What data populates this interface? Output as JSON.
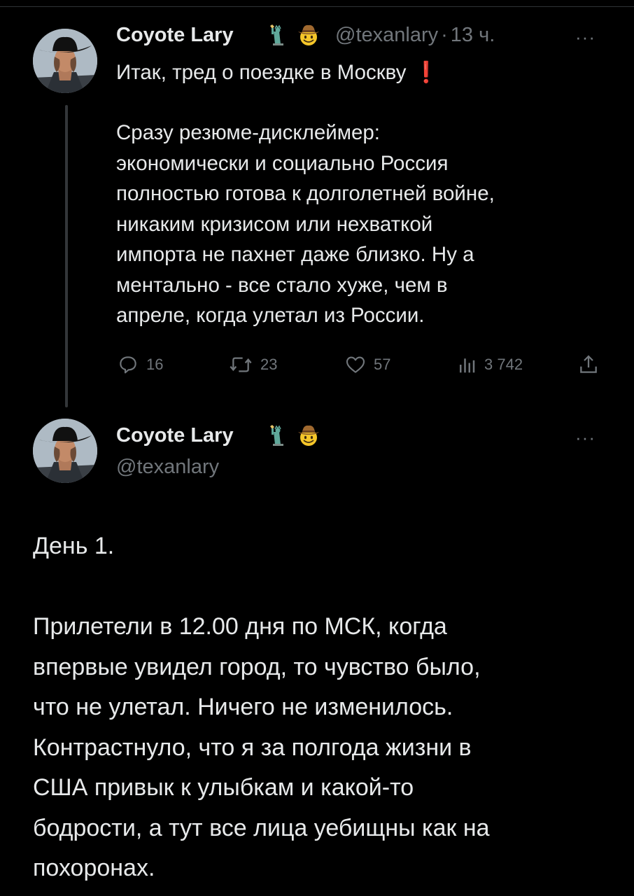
{
  "tweet1": {
    "display_name": "Coyote Lary",
    "handle": "@texanlary",
    "separator": "·",
    "time": "13 ч.",
    "title_line": "Итак, тред о поездке в Москву",
    "title_emoji": "❗",
    "body": "Сразу резюме-дисклеймер:\nэкономически и социально Россия\nполностью готова к долголетней войне,\nникаким кризисом или нехваткой\nимпорта не пахнет даже близко. Ну а\nментально - все стало хуже, чем в\nапреле, когда улетал из России.",
    "more": "···",
    "actions": {
      "replies": "16",
      "retweets": "23",
      "likes": "57",
      "views": "3 742"
    },
    "badges": [
      "statue-of-liberty-emoji",
      "cowboy-emoji"
    ]
  },
  "tweet2": {
    "display_name": "Coyote Lary",
    "handle": "@texanlary",
    "more": "···",
    "text": "День 1.\n\nПрилетели в 12.00 дня по МСК, когда\nвпервые увидел город, то чувство было,\nчто не улетал. Ничего не изменилось.\nКонтрастнуло, что я за полгода жизни в\nСША привык к улыбкам и какой-то\nбодрости, а тут все лица уебищны как на\nпохоронах.",
    "badges": [
      "statue-of-liberty-emoji",
      "cowboy-emoji"
    ]
  },
  "colors": {
    "background": "#000000",
    "text": "#e7e9ea",
    "secondary": "#71767b",
    "thread_line": "#333639",
    "alert_red": "#f4212e",
    "liberty_green": "#5fa89a",
    "cowboy_yellow": "#f5c629"
  }
}
